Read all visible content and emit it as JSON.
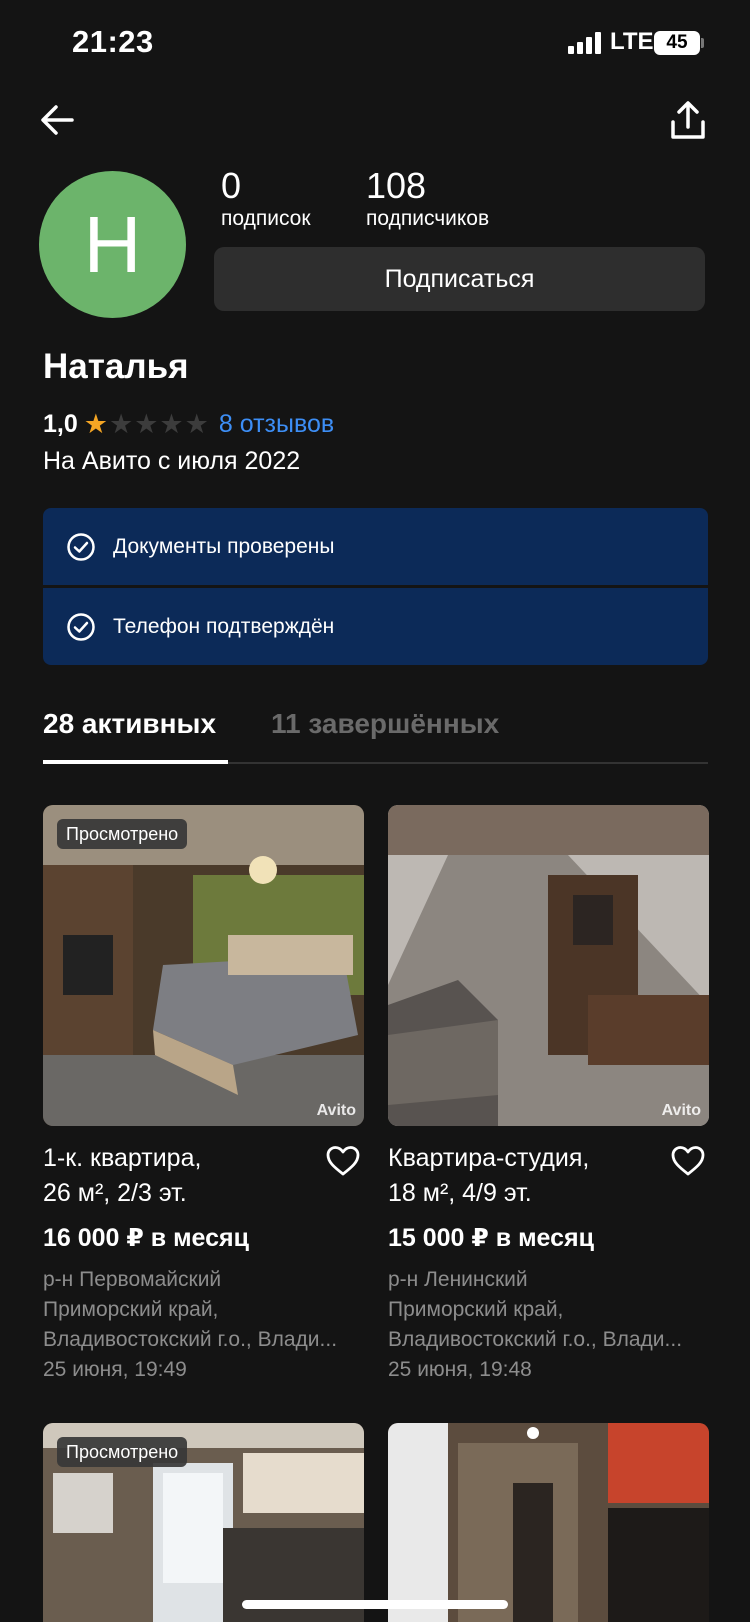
{
  "status_bar": {
    "time": "21:23",
    "network": "LTE",
    "battery": "45"
  },
  "profile": {
    "avatar_letter": "Н",
    "subscriptions_count": "0",
    "subscriptions_label": "подписок",
    "followers_count": "108",
    "followers_label": "подписчиков",
    "subscribe_button": "Подписаться",
    "name": "Наталья",
    "rating": "1,0",
    "rating_stars": 1,
    "reviews_link": "8 отзывов",
    "member_since": "На Авито с июля 2022"
  },
  "verifications": [
    {
      "label": "Документы проверены"
    },
    {
      "label": "Телефон подтверждён"
    }
  ],
  "tabs": [
    {
      "label": "28 активных",
      "active": true
    },
    {
      "label": "11 завершённых",
      "active": false
    }
  ],
  "listings": [
    {
      "badge": "Просмотрено",
      "watermark": "Avito",
      "title_line1": "1-к. квартира,",
      "title_line2": "26 м², 2/3 эт.",
      "price": "16 000 ₽ в месяц",
      "district": "р-н Первомайский",
      "region": "Приморский край,",
      "address": "Владивостокский г.о., Влади...",
      "date": "25 июня, 19:49"
    },
    {
      "badge": "",
      "watermark": "Avito",
      "title_line1": "Квартира-студия,",
      "title_line2": "18 м², 4/9 эт.",
      "price": "15 000 ₽ в месяц",
      "district": "р-н Ленинский",
      "region": "Приморский край,",
      "address": "Владивостокский г.о., Влади...",
      "date": "25 июня, 19:48"
    },
    {
      "badge": "Просмотрено"
    }
  ],
  "colors": {
    "background": "#141414",
    "accent_link": "#3d8ef5",
    "avatar": "#6cb46b",
    "verify_bg": "#0c2a58",
    "star_active": "#f4a524",
    "star_inactive": "#3c3c3c"
  }
}
